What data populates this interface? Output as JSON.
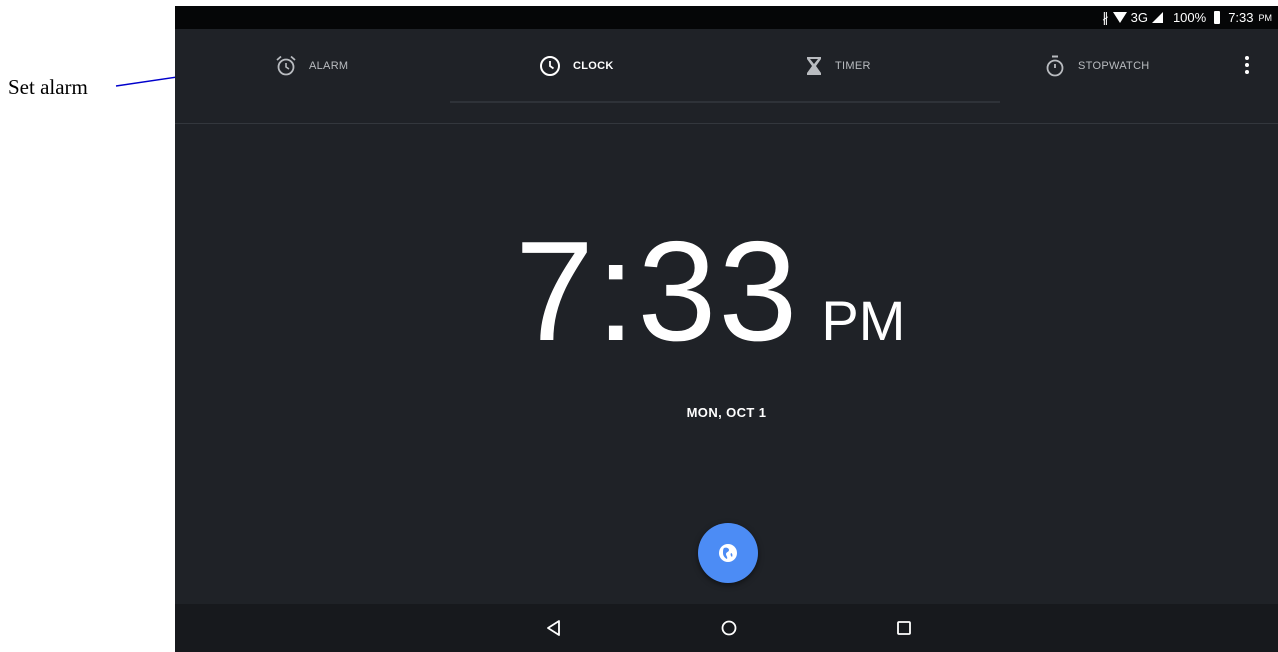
{
  "annotation": {
    "label": "Set alarm"
  },
  "status_bar": {
    "network": "3G",
    "battery": "100%",
    "time": "7:33",
    "ampm": "PM"
  },
  "tabs": [
    {
      "label": "ALARM",
      "icon": "alarm-clock-icon"
    },
    {
      "label": "CLOCK",
      "icon": "clock-icon",
      "active": true
    },
    {
      "label": "TIMER",
      "icon": "hourglass-icon"
    },
    {
      "label": "STOPWATCH",
      "icon": "stopwatch-icon"
    }
  ],
  "overflow_menu": {
    "icon": "more-vert-icon"
  },
  "clock": {
    "time": "7:33",
    "ampm": "PM",
    "date": "MON, OCT 1"
  },
  "fab": {
    "icon": "globe-icon"
  },
  "navbar": {
    "back": "back-icon",
    "home": "home-icon",
    "recents": "recents-icon"
  },
  "colors": {
    "background": "#1f2227",
    "fab": "#4c8cf5",
    "status_bar": "#050607",
    "annotation_arrow": "#0000cc"
  }
}
